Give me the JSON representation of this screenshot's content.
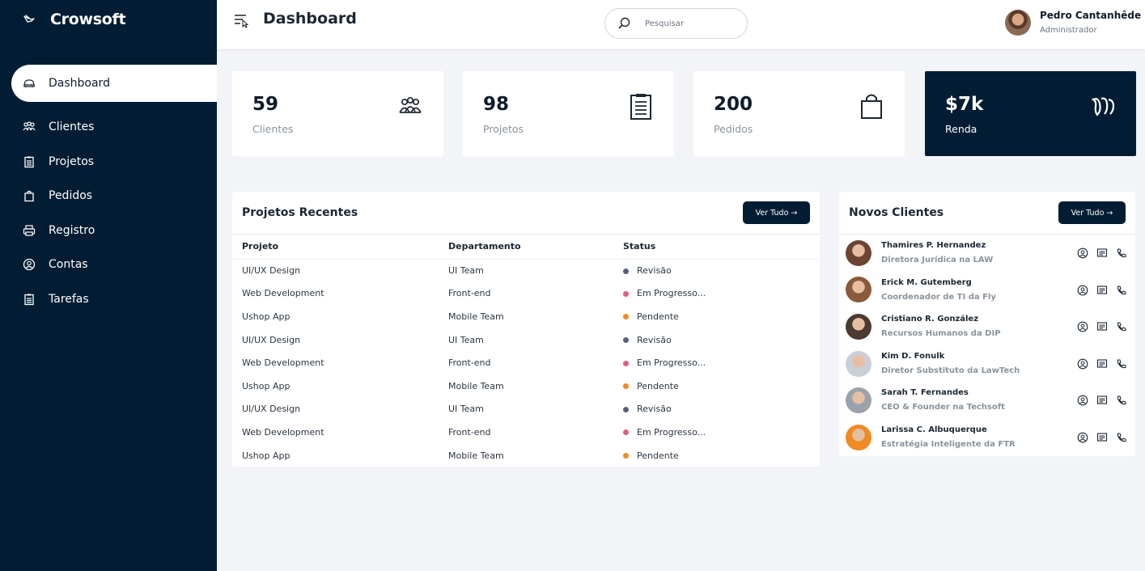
{
  "app": {
    "name": "Crowsoft"
  },
  "sidebar": {
    "items": [
      {
        "label": "Dashboard",
        "icon": "car-icon"
      },
      {
        "label": "Clientes",
        "icon": "users-icon"
      },
      {
        "label": "Projetos",
        "icon": "clipboard-icon"
      },
      {
        "label": "Pedidos",
        "icon": "bag-icon"
      },
      {
        "label": "Registro",
        "icon": "printer-icon"
      },
      {
        "label": "Contas",
        "icon": "user-circle-icon"
      },
      {
        "label": "Tarefas",
        "icon": "clipboard-icon"
      }
    ]
  },
  "header": {
    "title": "Dashboard",
    "search_placeholder": "Pesquisar",
    "user": {
      "name": "Pedro Cantanhêde",
      "role": "Administrador"
    }
  },
  "cards": [
    {
      "value": "59",
      "label": "Clientes",
      "icon": "users-icon"
    },
    {
      "value": "98",
      "label": "Projetos",
      "icon": "clipboard-icon"
    },
    {
      "value": "200",
      "label": "Pedidos",
      "icon": "bag-icon"
    },
    {
      "value": "$7k",
      "label": "Renda",
      "icon": "money-icon"
    }
  ],
  "projects": {
    "title": "Projetos Recentes",
    "button": "Ver Tudo →",
    "columns": [
      "Projeto",
      "Departamento",
      "Status"
    ],
    "rows": [
      {
        "project": "UI/UX Design",
        "dept": "UI Team",
        "status": "Revisão",
        "color": "#5a5f7a"
      },
      {
        "project": "Web Development",
        "dept": "Front-end",
        "status": "Em Progresso...",
        "color": "#e0607e"
      },
      {
        "project": "Ushop App",
        "dept": "Mobile Team",
        "status": "Pendente",
        "color": "#f08a24"
      },
      {
        "project": "UI/UX Design",
        "dept": "UI Team",
        "status": "Revisão",
        "color": "#5a5f7a"
      },
      {
        "project": "Web Development",
        "dept": "Front-end",
        "status": "Em Progresso...",
        "color": "#e0607e"
      },
      {
        "project": "Ushop App",
        "dept": "Mobile Team",
        "status": "Pendente",
        "color": "#f08a24"
      },
      {
        "project": "UI/UX Design",
        "dept": "UI Team",
        "status": "Revisão",
        "color": "#5a5f7a"
      },
      {
        "project": "Web Development",
        "dept": "Front-end",
        "status": "Em Progresso...",
        "color": "#e0607e"
      },
      {
        "project": "Ushop App",
        "dept": "Mobile Team",
        "status": "Pendente",
        "color": "#f08a24"
      }
    ]
  },
  "clients": {
    "title": "Novos Clientes",
    "button": "Ver Tudo →",
    "items": [
      {
        "name": "Thamires P. Hernandez",
        "role": "Diretora Jurídica na LAW",
        "avatar": "#6b4434"
      },
      {
        "name": "Erick M. Gutemberg",
        "role": "Coordenador de TI da Fly",
        "avatar": "#8a5a3a"
      },
      {
        "name": "Cristiano R. González",
        "role": "Recursos Humanos da DIP",
        "avatar": "#4a3a30"
      },
      {
        "name": "Kim D. Fonulk",
        "role": "Diretor Substituto da LawTech",
        "avatar": "#c9cfd6"
      },
      {
        "name": "Sarah T. Fernandes",
        "role": "CEO & Founder na Techsoft",
        "avatar": "#9aa2ac"
      },
      {
        "name": "Larissa C. Albuquerque",
        "role": "Estratégia Inteligente da FTR",
        "avatar": "#f08a24"
      }
    ]
  }
}
